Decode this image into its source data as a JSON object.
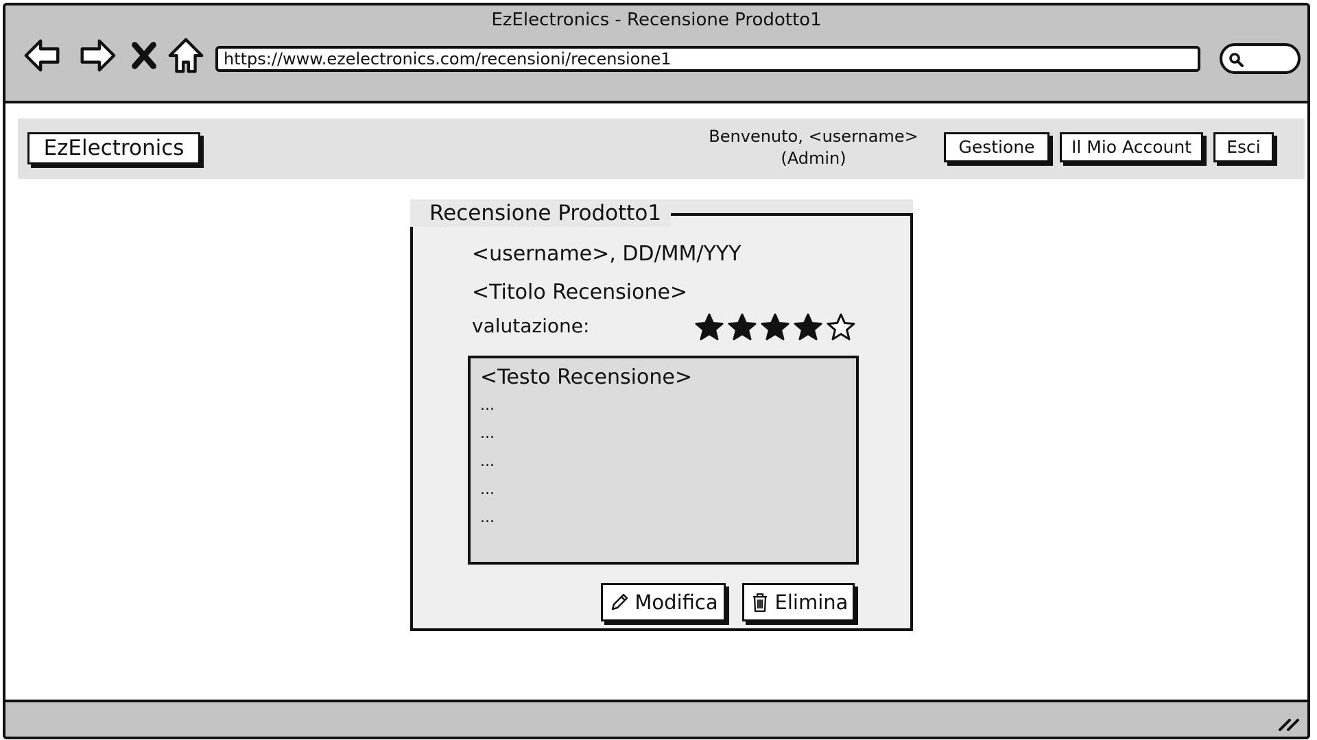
{
  "browser": {
    "window_title": "EzElectronics - Recensione Prodotto1",
    "url": "https://www.ezelectronics.com/recensioni/recensione1"
  },
  "header": {
    "logo": "EzElectronics",
    "welcome_line1": "Benvenuto, <username>",
    "welcome_line2": "(Admin)",
    "nav": [
      "Gestione",
      "Il Mio Account",
      "Esci"
    ]
  },
  "review": {
    "panel_title": "Recensione Prodotto1",
    "author_date": "<username>, DD/MM/YYY",
    "title": "<Titolo Recensione>",
    "rating_label": "valutazione:",
    "rating": 4,
    "rating_max": 5,
    "body_title": "<Testo Recensione>",
    "body_lines": [
      "...",
      "...",
      "...",
      "...",
      "..."
    ],
    "edit_label": "Modifica",
    "delete_label": "Elimina"
  },
  "icons": {
    "back": "back-arrow-icon",
    "forward": "forward-arrow-icon",
    "stop": "close-icon",
    "home": "home-icon",
    "search": "search-icon",
    "edit": "pencil-icon",
    "delete": "trash-icon",
    "resize": "resize-grip-icon"
  },
  "colors": {
    "chrome": "#c4c4c4",
    "appbar": "#e2e2e2",
    "panel": "#efefef",
    "textbox": "#dcdcdc"
  }
}
